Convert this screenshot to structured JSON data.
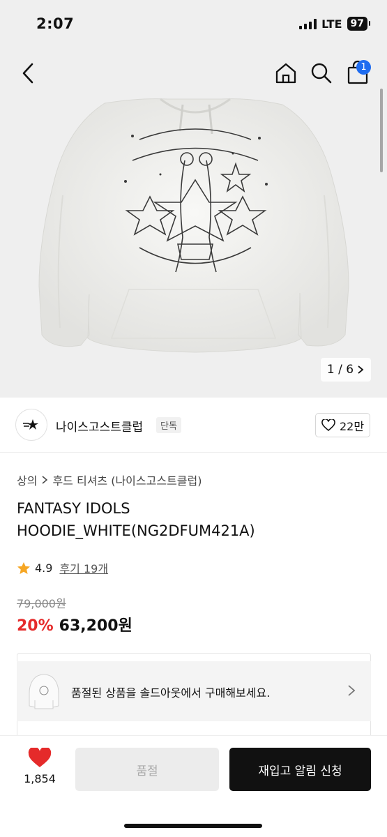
{
  "status_bar": {
    "time": "2:07",
    "network": "LTE",
    "battery": "97"
  },
  "header": {
    "cart_count": "1"
  },
  "gallery": {
    "counter": "1 / 6",
    "colors": {
      "background": "#efefef",
      "hoodie": "#f4f4f2",
      "print": "#3a3a3a"
    }
  },
  "brand": {
    "name": "나이스고스트클럽",
    "tag": "단독",
    "likes": "22만"
  },
  "breadcrumb": {
    "category": "상의",
    "subcategory": "후드 티셔츠 (나이스고스트클럽)"
  },
  "product": {
    "title": "FANTASY IDOLS HOODIE_WHITE(NG2DFUM421A)",
    "rating": "4.9",
    "reviews": "후기 19개",
    "original_price": "79,000원",
    "discount": "20%",
    "price": "63,200원"
  },
  "soldout_notice": {
    "text": "품절된 상품을 솔드아웃에서 구매해보세요."
  },
  "bottom_bar": {
    "like_count": "1,854",
    "soldout_label": "품절",
    "notify_label": "재입고 알림 신청"
  },
  "colors": {
    "accent_red": "#e52a2a",
    "badge_blue": "#1e6cf0",
    "star": "#f6a623"
  }
}
